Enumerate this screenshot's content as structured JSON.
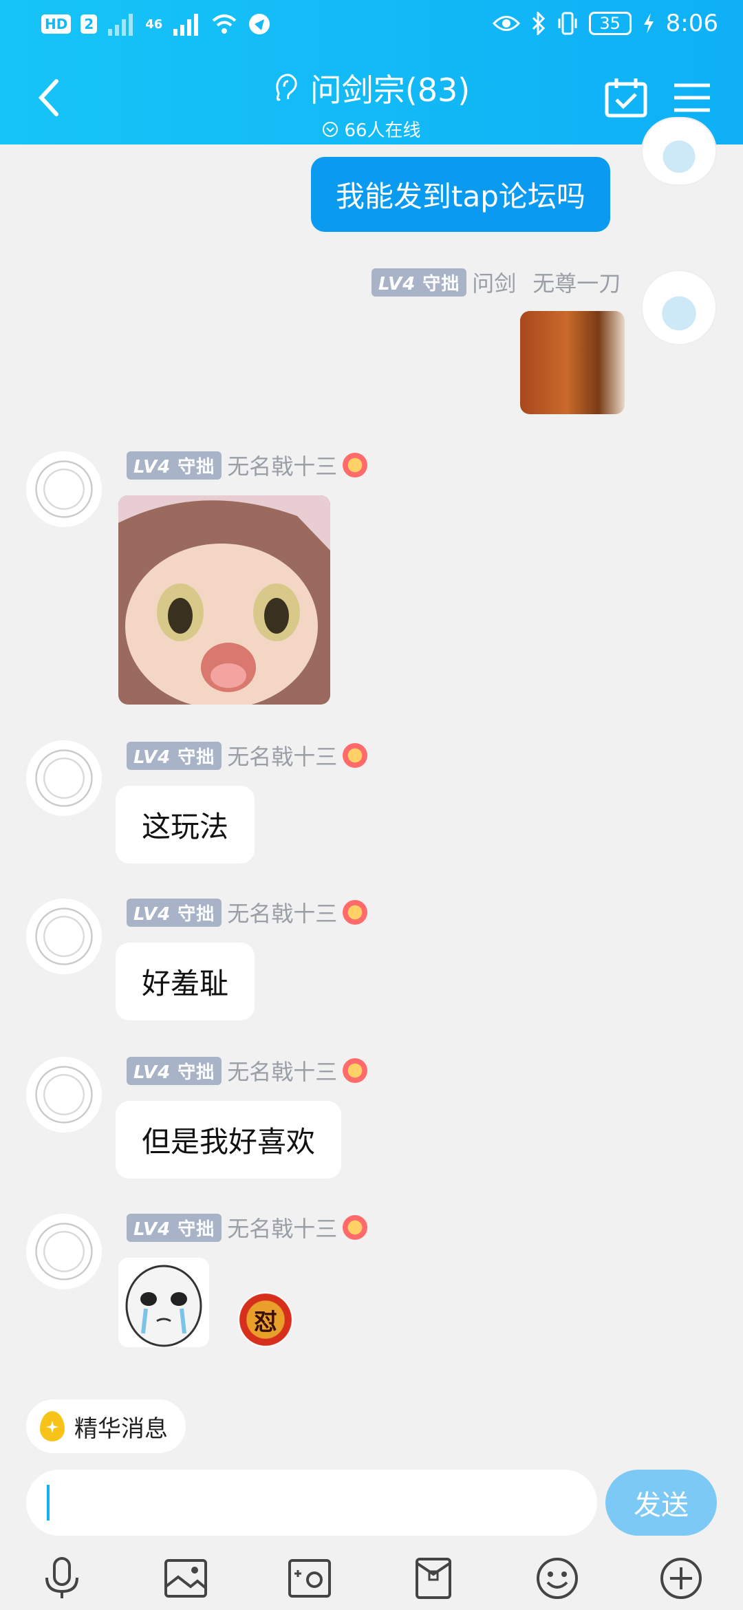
{
  "status_bar": {
    "time": "8:06",
    "battery": "35",
    "chip_hd": "HD",
    "chip_2": "2",
    "net": "46"
  },
  "header": {
    "title": "问剑宗(83)",
    "online": "66人在线"
  },
  "messages": {
    "out1": {
      "text": "我能发到tap论坛吗"
    },
    "out2": {
      "level": "LV4",
      "rank": "守拙",
      "sender": "问剑",
      "extra": "无尊一刀"
    },
    "in1": {
      "level": "LV4",
      "rank": "守拙",
      "sender": "无名戟十三"
    },
    "in2": {
      "level": "LV4",
      "rank": "守拙",
      "sender": "无名戟十三",
      "text": "这玩法"
    },
    "in3": {
      "level": "LV4",
      "rank": "守拙",
      "sender": "无名戟十三",
      "text": "好羞耻"
    },
    "in4": {
      "level": "LV4",
      "rank": "守拙",
      "sender": "无名戟十三",
      "text": "但是我好喜欢"
    },
    "in5": {
      "level": "LV4",
      "rank": "守拙",
      "sender": "无名戟十三",
      "emoji_char": "怼"
    }
  },
  "footer": {
    "featured": "精华消息",
    "send": "发送",
    "input_placeholder": ""
  },
  "toolbar": [
    "mic-icon",
    "image-icon",
    "camera-icon",
    "file-icon",
    "emoji-icon",
    "add-icon"
  ],
  "colors": {
    "header": "#13b9f6",
    "bubble_out": "#0a9bf0",
    "send": "#7cc9f5",
    "level_badge": "#a9b3c8"
  }
}
